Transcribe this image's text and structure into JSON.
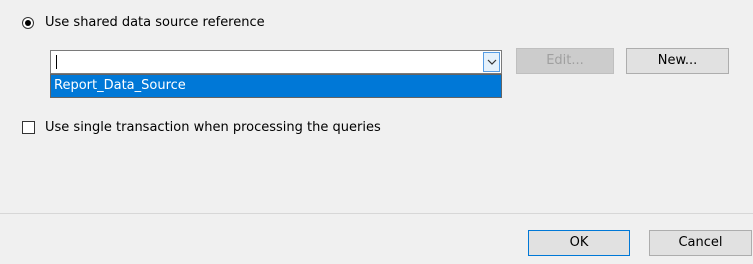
{
  "data_source": {
    "shared_option_label": "Use shared data source reference",
    "shared_option_selected": true,
    "combo_value": "",
    "dropdown_items": [
      "Report_Data_Source"
    ],
    "edit_button": "Edit...",
    "new_button": "New..."
  },
  "options": {
    "single_transaction_label": "Use single transaction when processing the queries",
    "single_transaction_checked": false
  },
  "footer": {
    "ok_button": "OK",
    "cancel_button": "Cancel"
  },
  "colors": {
    "dialog_background": "#f0f0f0",
    "selection_highlight": "#0078d7",
    "disabled_button": "#cccccc"
  }
}
